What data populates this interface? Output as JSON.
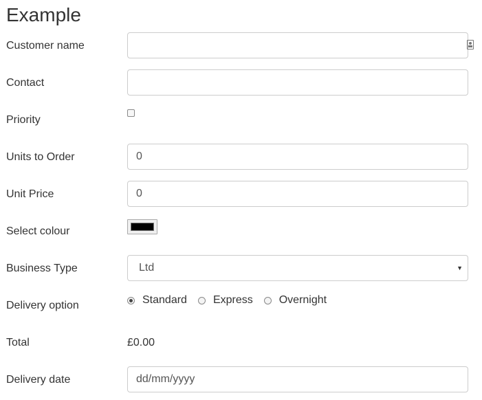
{
  "form": {
    "title": "Example",
    "customer_name": {
      "label": "Customer name",
      "value": ""
    },
    "contact": {
      "label": "Contact",
      "value": ""
    },
    "priority": {
      "label": "Priority",
      "checked": false
    },
    "units_to_order": {
      "label": "Units to Order",
      "value": "0"
    },
    "unit_price": {
      "label": "Unit Price",
      "value": "0"
    },
    "select_colour": {
      "label": "Select colour",
      "value": "#000000"
    },
    "business_type": {
      "label": "Business Type",
      "value": "Ltd"
    },
    "delivery_option": {
      "label": "Delivery option",
      "options": [
        {
          "label": "Standard",
          "checked": true
        },
        {
          "label": "Express",
          "checked": false
        },
        {
          "label": "Overnight",
          "checked": false
        }
      ]
    },
    "total": {
      "label": "Total",
      "value": "£0.00"
    },
    "delivery_date": {
      "label": "Delivery date",
      "placeholder": "dd/mm/yyyy"
    }
  }
}
